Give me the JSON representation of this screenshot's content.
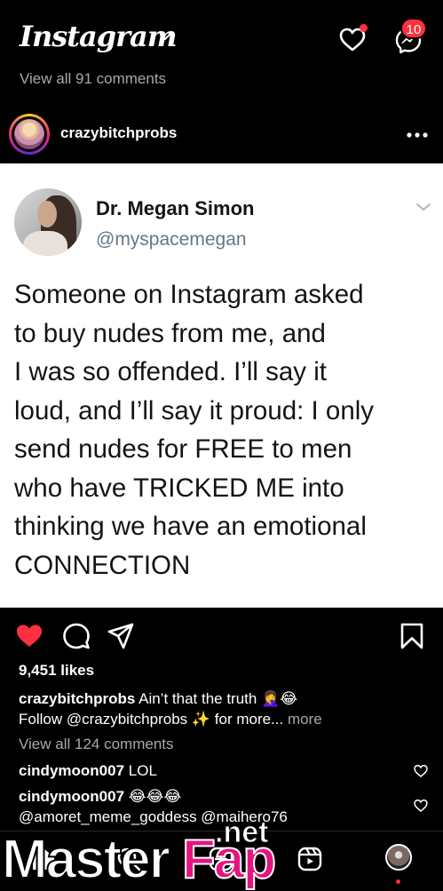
{
  "topbar": {
    "logo": "Instagram",
    "messages_badge": "10"
  },
  "previous_post": {
    "view_comments": "View all 91 comments"
  },
  "post": {
    "username": "crazybitchprobs",
    "tweet": {
      "display_name": "Dr. Megan Simon",
      "handle": "@myspacemegan",
      "lines": [
        "Someone on Instagram asked",
        "to buy nudes from me, and",
        "I was so offended. I’ll say it",
        "loud, and I’ll say it proud: I only",
        "send nudes for FREE to men",
        "who have TRICKED ME into",
        "thinking we have an emotional",
        "CONNECTION"
      ]
    },
    "likes": "9,451 likes",
    "caption": {
      "username": "crazybitchprobs",
      "text": "Ain’t that the truth 🤦‍♀️😂",
      "line2": "Follow @crazybitchprobs ✨  for more...",
      "more": "more"
    },
    "view_comments": "View all 124 comments",
    "comments": [
      {
        "username": "cindymoon007",
        "text": "LOL"
      },
      {
        "username": "cindymoon007",
        "text": "😂😂😂",
        "line2": "@amoret_meme_goddess @maihero76"
      }
    ]
  },
  "watermark": {
    "part1": "Master",
    "part2": "Fap",
    "suffix": ".net"
  },
  "colors": {
    "like_red": "#ff3040",
    "watermark_pink": "#e4157f",
    "muted": "#a8a8a8"
  },
  "icons": {
    "topbar": [
      "chevron-down-icon",
      "heart-icon",
      "messenger-icon"
    ],
    "post": [
      "more-icon",
      "like-icon",
      "comment-icon",
      "share-icon",
      "save-icon"
    ],
    "nav": [
      "home-icon",
      "search-icon",
      "add-icon",
      "reels-icon",
      "profile-icon"
    ]
  }
}
